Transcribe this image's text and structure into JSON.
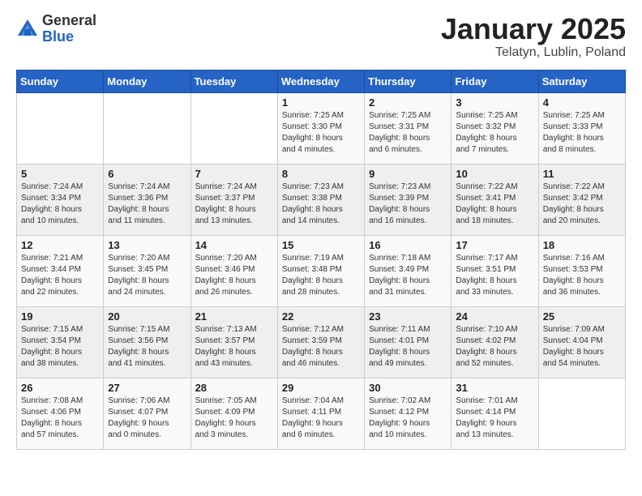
{
  "logo": {
    "general": "General",
    "blue": "Blue"
  },
  "title": "January 2025",
  "subtitle": "Telatyn, Lublin, Poland",
  "days_of_week": [
    "Sunday",
    "Monday",
    "Tuesday",
    "Wednesday",
    "Thursday",
    "Friday",
    "Saturday"
  ],
  "weeks": [
    [
      {
        "day": "",
        "content": ""
      },
      {
        "day": "",
        "content": ""
      },
      {
        "day": "",
        "content": ""
      },
      {
        "day": "1",
        "content": "Sunrise: 7:25 AM\nSunset: 3:30 PM\nDaylight: 8 hours\nand 4 minutes."
      },
      {
        "day": "2",
        "content": "Sunrise: 7:25 AM\nSunset: 3:31 PM\nDaylight: 8 hours\nand 6 minutes."
      },
      {
        "day": "3",
        "content": "Sunrise: 7:25 AM\nSunset: 3:32 PM\nDaylight: 8 hours\nand 7 minutes."
      },
      {
        "day": "4",
        "content": "Sunrise: 7:25 AM\nSunset: 3:33 PM\nDaylight: 8 hours\nand 8 minutes."
      }
    ],
    [
      {
        "day": "5",
        "content": "Sunrise: 7:24 AM\nSunset: 3:34 PM\nDaylight: 8 hours\nand 10 minutes."
      },
      {
        "day": "6",
        "content": "Sunrise: 7:24 AM\nSunset: 3:36 PM\nDaylight: 8 hours\nand 11 minutes."
      },
      {
        "day": "7",
        "content": "Sunrise: 7:24 AM\nSunset: 3:37 PM\nDaylight: 8 hours\nand 13 minutes."
      },
      {
        "day": "8",
        "content": "Sunrise: 7:23 AM\nSunset: 3:38 PM\nDaylight: 8 hours\nand 14 minutes."
      },
      {
        "day": "9",
        "content": "Sunrise: 7:23 AM\nSunset: 3:39 PM\nDaylight: 8 hours\nand 16 minutes."
      },
      {
        "day": "10",
        "content": "Sunrise: 7:22 AM\nSunset: 3:41 PM\nDaylight: 8 hours\nand 18 minutes."
      },
      {
        "day": "11",
        "content": "Sunrise: 7:22 AM\nSunset: 3:42 PM\nDaylight: 8 hours\nand 20 minutes."
      }
    ],
    [
      {
        "day": "12",
        "content": "Sunrise: 7:21 AM\nSunset: 3:44 PM\nDaylight: 8 hours\nand 22 minutes."
      },
      {
        "day": "13",
        "content": "Sunrise: 7:20 AM\nSunset: 3:45 PM\nDaylight: 8 hours\nand 24 minutes."
      },
      {
        "day": "14",
        "content": "Sunrise: 7:20 AM\nSunset: 3:46 PM\nDaylight: 8 hours\nand 26 minutes."
      },
      {
        "day": "15",
        "content": "Sunrise: 7:19 AM\nSunset: 3:48 PM\nDaylight: 8 hours\nand 28 minutes."
      },
      {
        "day": "16",
        "content": "Sunrise: 7:18 AM\nSunset: 3:49 PM\nDaylight: 8 hours\nand 31 minutes."
      },
      {
        "day": "17",
        "content": "Sunrise: 7:17 AM\nSunset: 3:51 PM\nDaylight: 8 hours\nand 33 minutes."
      },
      {
        "day": "18",
        "content": "Sunrise: 7:16 AM\nSunset: 3:53 PM\nDaylight: 8 hours\nand 36 minutes."
      }
    ],
    [
      {
        "day": "19",
        "content": "Sunrise: 7:15 AM\nSunset: 3:54 PM\nDaylight: 8 hours\nand 38 minutes."
      },
      {
        "day": "20",
        "content": "Sunrise: 7:15 AM\nSunset: 3:56 PM\nDaylight: 8 hours\nand 41 minutes."
      },
      {
        "day": "21",
        "content": "Sunrise: 7:13 AM\nSunset: 3:57 PM\nDaylight: 8 hours\nand 43 minutes."
      },
      {
        "day": "22",
        "content": "Sunrise: 7:12 AM\nSunset: 3:59 PM\nDaylight: 8 hours\nand 46 minutes."
      },
      {
        "day": "23",
        "content": "Sunrise: 7:11 AM\nSunset: 4:01 PM\nDaylight: 8 hours\nand 49 minutes."
      },
      {
        "day": "24",
        "content": "Sunrise: 7:10 AM\nSunset: 4:02 PM\nDaylight: 8 hours\nand 52 minutes."
      },
      {
        "day": "25",
        "content": "Sunrise: 7:09 AM\nSunset: 4:04 PM\nDaylight: 8 hours\nand 54 minutes."
      }
    ],
    [
      {
        "day": "26",
        "content": "Sunrise: 7:08 AM\nSunset: 4:06 PM\nDaylight: 8 hours\nand 57 minutes."
      },
      {
        "day": "27",
        "content": "Sunrise: 7:06 AM\nSunset: 4:07 PM\nDaylight: 9 hours\nand 0 minutes."
      },
      {
        "day": "28",
        "content": "Sunrise: 7:05 AM\nSunset: 4:09 PM\nDaylight: 9 hours\nand 3 minutes."
      },
      {
        "day": "29",
        "content": "Sunrise: 7:04 AM\nSunset: 4:11 PM\nDaylight: 9 hours\nand 6 minutes."
      },
      {
        "day": "30",
        "content": "Sunrise: 7:02 AM\nSunset: 4:12 PM\nDaylight: 9 hours\nand 10 minutes."
      },
      {
        "day": "31",
        "content": "Sunrise: 7:01 AM\nSunset: 4:14 PM\nDaylight: 9 hours\nand 13 minutes."
      },
      {
        "day": "",
        "content": ""
      }
    ]
  ]
}
